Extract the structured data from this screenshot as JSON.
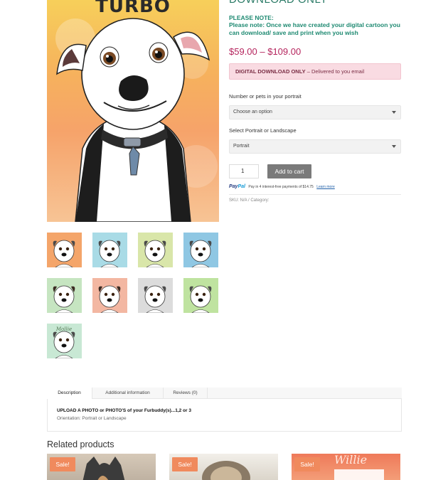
{
  "product": {
    "image_title": "TURBO",
    "cut_heading": "DOWNLOAD ONLY",
    "note_title": "PLEASE NOTE:",
    "note_body": "Please note: Once we have created your digital cartoon you can download/ save and print when you wish",
    "price_range": "$59.00 – $109.00",
    "notice_bold": "DIGITAL DOWNLOAD ONLY",
    "notice_rest": " – Delivered to you email",
    "pets_label": "Number or pets in your portrait",
    "pets_value": "Choose an option",
    "orientation_label": "Select Portrait or Landscape",
    "orientation_value": "Portrait",
    "quantity": "1",
    "add_to_cart": "Add to cart",
    "paypal_brand_pay": "Pay",
    "paypal_brand_pal": "Pal",
    "paypal_text": "Pay in 4 interest-free payments of $14.75",
    "paypal_learn": "Learn more",
    "sku": "SKU: N/A / Category:"
  },
  "thumbnails": [
    {
      "name": "thumb-boxer-orange",
      "bg": "#f4a56a"
    },
    {
      "name": "thumb-dog-blue",
      "bg": "#a9dbe6"
    },
    {
      "name": "thumb-dog-green",
      "bg": "#d9e6a9"
    },
    {
      "name": "thumb-dog-blue-2",
      "bg": "#8fc7e3"
    },
    {
      "name": "thumb-spaniel-green",
      "bg": "#c6e5c1"
    },
    {
      "name": "thumb-shepherds-pink",
      "bg": "#f3b7a2"
    },
    {
      "name": "thumb-boxer-grey",
      "bg": "#dcdcdc"
    },
    {
      "name": "thumb-dog-lime",
      "bg": "#bfe3a0"
    },
    {
      "name": "thumb-two-dogs",
      "bg": "#c8e8d4",
      "caption": "Mollie"
    }
  ],
  "tabs": {
    "description": "Description",
    "additional": "Additional information",
    "reviews": "Reviews (0)",
    "content_title": "UPLOAD A PHOTO or PHOTO'S of your Furbuddy(s)...1,2 or 3",
    "content_sub": "Orientation: Portrait or Landscape"
  },
  "related": {
    "title": "Related products",
    "sale_label": "Sale!",
    "third_caption": "Willie"
  },
  "colors": {
    "accent_green": "#1f8a72",
    "price": "#b5245d",
    "sale": "#f08a5d"
  }
}
